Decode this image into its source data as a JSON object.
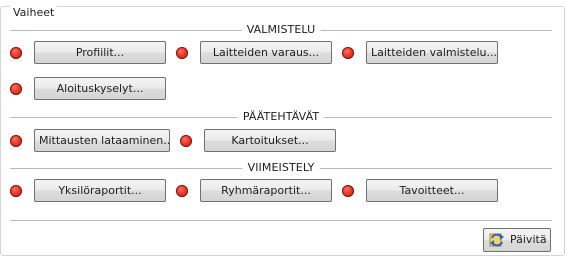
{
  "group": {
    "title": "Vaiheet"
  },
  "sections": {
    "preparation": "VALMISTELU",
    "main_tasks": "PÄÄTEHTÄVÄT",
    "finishing": "VIIMEISTELY"
  },
  "buttons": {
    "profiles": "Profiilit...",
    "device_reservation": "Laitteiden varaus...",
    "device_preparation": "Laitteiden valmistelu...",
    "start_surveys": "Aloituskyselyt...",
    "load_measurements": "Mittausten lataaminen...",
    "mappings": "Kartoitukset...",
    "individual_reports": "Yksilöraportit...",
    "group_reports": "Ryhmäraportit...",
    "goals": "Tavoitteet...",
    "refresh": "Päivitä"
  },
  "colors": {
    "status_dot": "#e33a2a"
  },
  "icons": {
    "status": "red-status-dot-icon",
    "refresh": "refresh-arrows-icon"
  }
}
